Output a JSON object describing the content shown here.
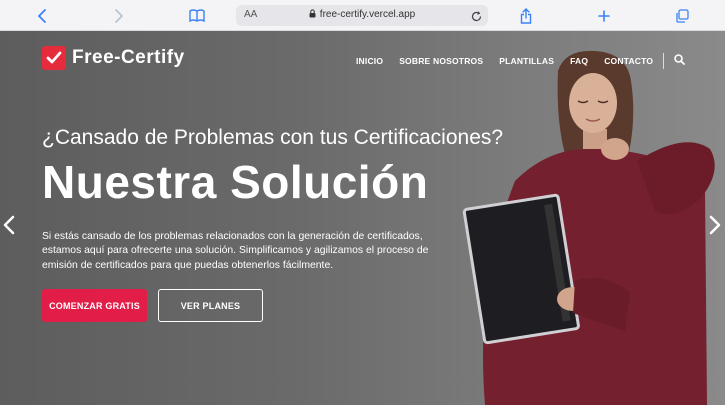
{
  "browser": {
    "url": "free-certify.vercel.app",
    "aa_label": "AA"
  },
  "site": {
    "logo_text": "Free-Certify",
    "nav": [
      "INICIO",
      "SOBRE NOSOTROS",
      "PLANTILLAS",
      "FAQ",
      "CONTACTO"
    ]
  },
  "hero": {
    "subtitle": "¿Cansado de Problemas con tus Certificaciones?",
    "title": "Nuestra Solución",
    "description": "Si estás cansado de los problemas relacionados con la generación de certificados, estamos aquí para ofrecerte una solución. Simplificamos y agilizamos el proceso de emisión de certificados para que puedas obtenerlos fácilmente.",
    "primary_button": "COMENZAR GRATIS",
    "secondary_button": "VER PLANES"
  },
  "colors": {
    "brand": "#e52b3c",
    "primary_button": "#e11d48",
    "toolbar_accent": "#3b82f6"
  },
  "icons": [
    "back-icon",
    "forward-icon",
    "bookmarks-icon",
    "lock-icon",
    "reload-icon",
    "share-icon",
    "new-tab-icon",
    "tabs-icon",
    "search-icon",
    "prev-slide-icon",
    "next-slide-icon"
  ]
}
